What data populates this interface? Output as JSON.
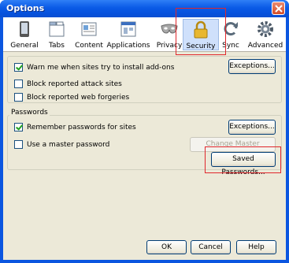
{
  "window": {
    "title": "Options"
  },
  "toolbar": {
    "items": [
      {
        "label": "General",
        "icon": "general-icon"
      },
      {
        "label": "Tabs",
        "icon": "tabs-icon"
      },
      {
        "label": "Content",
        "icon": "content-icon"
      },
      {
        "label": "Applications",
        "icon": "applications-icon"
      },
      {
        "label": "Privacy",
        "icon": "privacy-mask-icon"
      },
      {
        "label": "Security",
        "icon": "padlock-icon",
        "selected": true
      },
      {
        "label": "Sync",
        "icon": "sync-icon"
      },
      {
        "label": "Advanced",
        "icon": "gear-icon"
      }
    ]
  },
  "addons_section": {
    "warn_addons": {
      "label": "Warn me when sites try to install add-ons",
      "checked": true
    },
    "exceptions_button": "Exceptions...",
    "block_attack": {
      "label": "Block reported attack sites",
      "checked": false
    },
    "block_forgeries": {
      "label": "Block reported web forgeries",
      "checked": false
    }
  },
  "passwords_section": {
    "legend": "Passwords",
    "remember": {
      "label": "Remember passwords for sites",
      "checked": true
    },
    "exceptions_button": "Exceptions...",
    "master": {
      "label": "Use a master password",
      "checked": false
    },
    "change_master_button": "Change Master Password...",
    "saved_passwords_button": "Saved Passwords..."
  },
  "footer": {
    "ok": "OK",
    "cancel": "Cancel",
    "help": "Help"
  },
  "colors": {
    "title_bar": "#0a5ae6",
    "dialog_bg": "#ece9d8",
    "annotation_red": "#e0272c"
  }
}
